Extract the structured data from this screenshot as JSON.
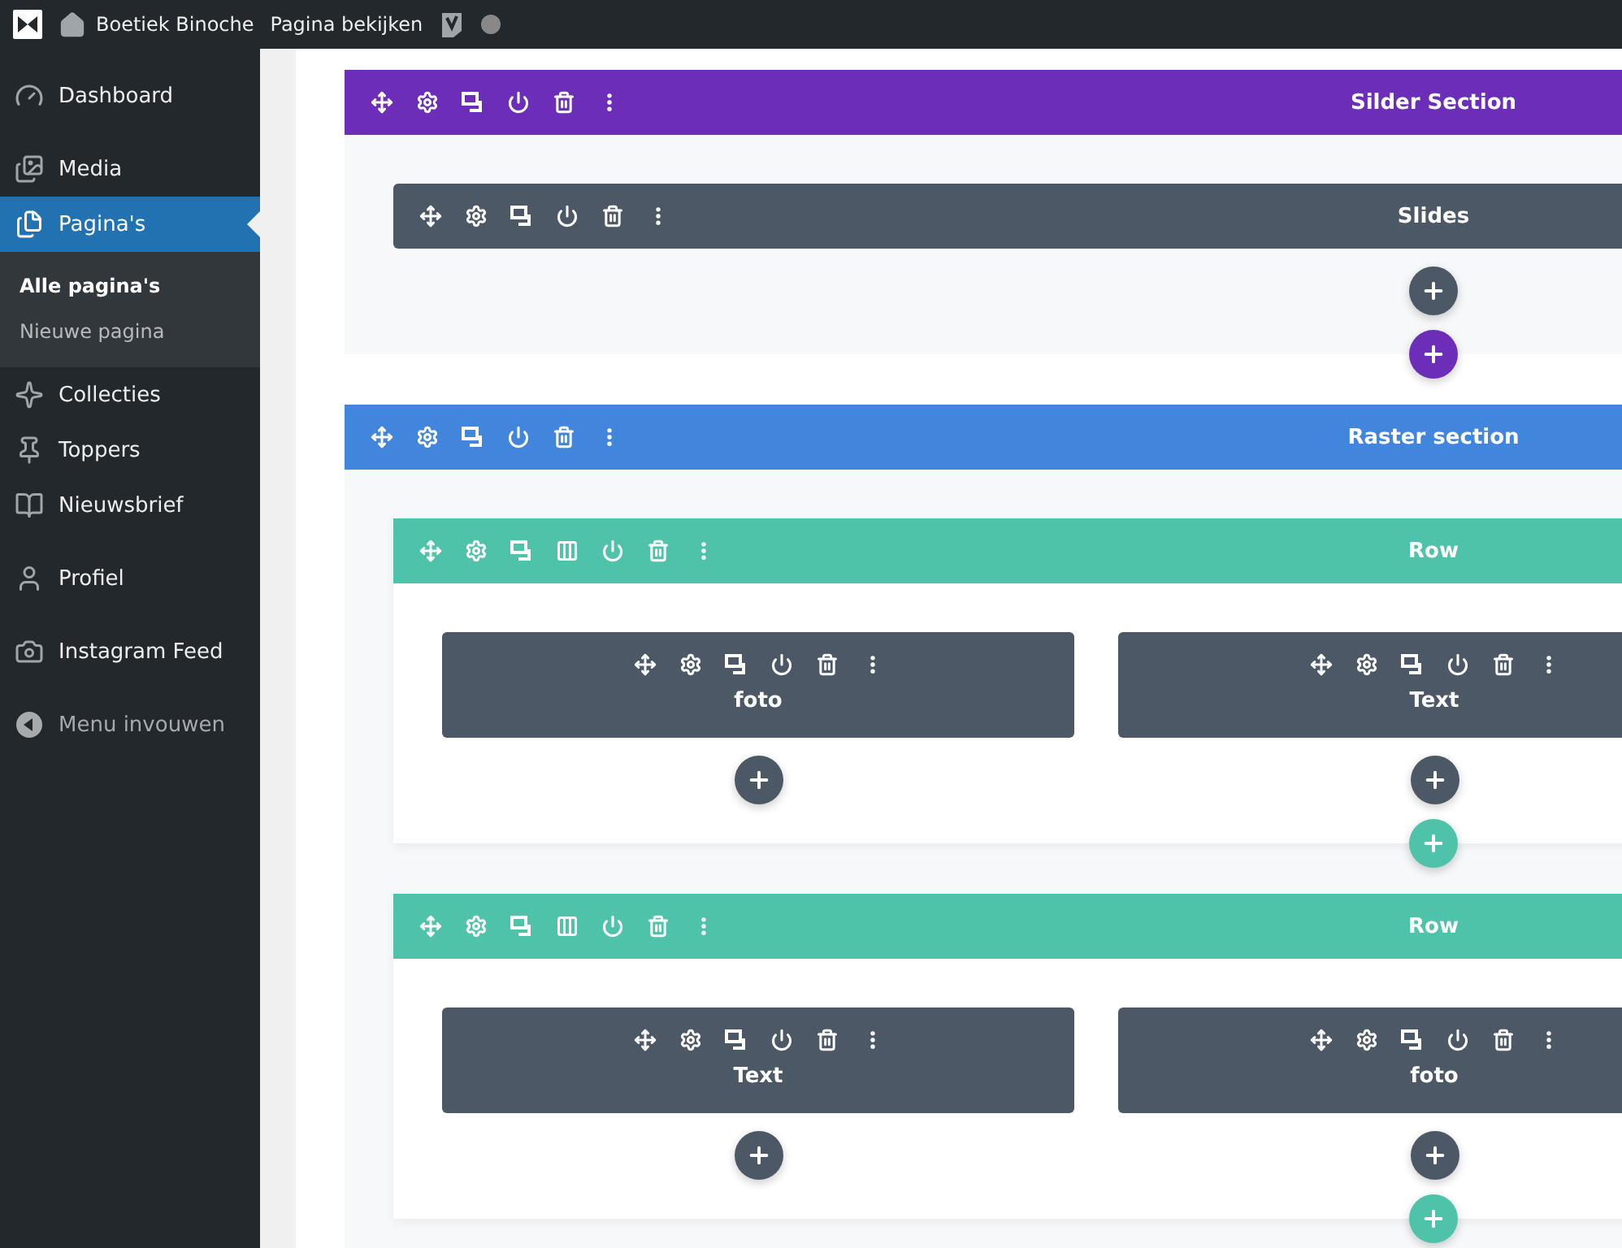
{
  "admin_bar": {
    "site": "Boetiek Binoche",
    "view_link": "Pagina bekijken"
  },
  "sidebar": {
    "groups": [
      [
        {
          "label": "Dashboard",
          "selected": false
        }
      ],
      [
        {
          "label": "Media",
          "selected": false
        },
        {
          "label": "Pagina's",
          "selected": true,
          "children": [
            {
              "label": "Alle pagina's",
              "selected": true
            },
            {
              "label": "Nieuwe pagina",
              "selected": false
            }
          ]
        },
        {
          "label": "Collecties",
          "selected": false
        },
        {
          "label": "Toppers",
          "selected": false
        },
        {
          "label": "Nieuwsbrief",
          "selected": false
        }
      ],
      [
        {
          "label": "Profiel",
          "selected": false
        }
      ],
      [
        {
          "label": "Instagram Feed",
          "selected": false
        }
      ]
    ],
    "collapse_label": "Menu invouwen"
  },
  "sections": [
    {
      "kind": "fullwidth",
      "title": "Silder Section",
      "color": "#6c2eb9",
      "modules": [
        {
          "title": "Slides"
        }
      ]
    },
    {
      "kind": "regular",
      "title": "Raster section",
      "color": "#4285dc",
      "rows": [
        {
          "title": "Row",
          "columns": [
            {
              "modules": [
                {
                  "title": "foto"
                }
              ]
            },
            {
              "modules": [
                {
                  "title": "Text"
                }
              ]
            }
          ]
        },
        {
          "title": "Row",
          "columns": [
            {
              "modules": [
                {
                  "title": "Text"
                }
              ]
            },
            {
              "modules": [
                {
                  "title": "foto"
                }
              ]
            }
          ]
        }
      ]
    }
  ]
}
